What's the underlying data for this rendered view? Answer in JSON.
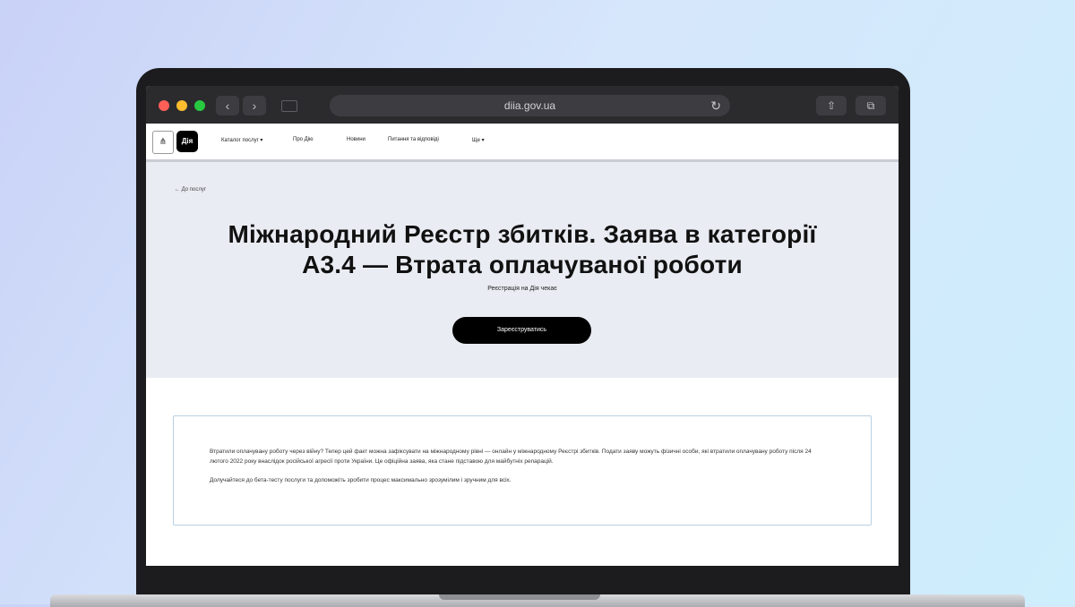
{
  "browser": {
    "url": "diia.gov.ua",
    "back_icon": "‹",
    "forward_icon": "›",
    "reload_icon": "↻",
    "share_icon": "⇧",
    "tabs_icon": "⧉"
  },
  "site_header": {
    "gerb_icon": "⋔",
    "logo_text": "Дія",
    "nav": [
      "Каталог послуг ▾",
      "Про Дію",
      "Новини",
      "Питання та відповіді",
      "Ще ▾"
    ]
  },
  "hero": {
    "back_link": "←  До послуг",
    "title_line1": "Міжнародний Реєстр збитків. Заява в категорії",
    "title_line2": "A3.4 — Втрата оплачуваної роботи",
    "subtitle": "Реєстрація на Дія чекає",
    "button_label": "Зареєструватись"
  },
  "info": {
    "para1": "Втратили оплачувану роботу через війну? Тепер цей факт можна зафіксувати на міжнародному рівні — онлайн у міжнародному Реєстрі збитків. Подати заяву можуть фізичні особи, які втратили оплачувану роботу після 24 лютого 2022 року внаслідок російської агресії проти України. Це офіційна заява, яка стане підставою для майбутніх репарацій.",
    "para2": "Долучайтеся до бета-тесту послуги та допоможіть зробити процес максимально зрозумілим і зручним для всіх."
  },
  "colors": {
    "chrome": "#2b2b2e",
    "hero_bg": "#e9ecf2",
    "button_bg": "#000000",
    "card_border": "#b9cfe0"
  }
}
